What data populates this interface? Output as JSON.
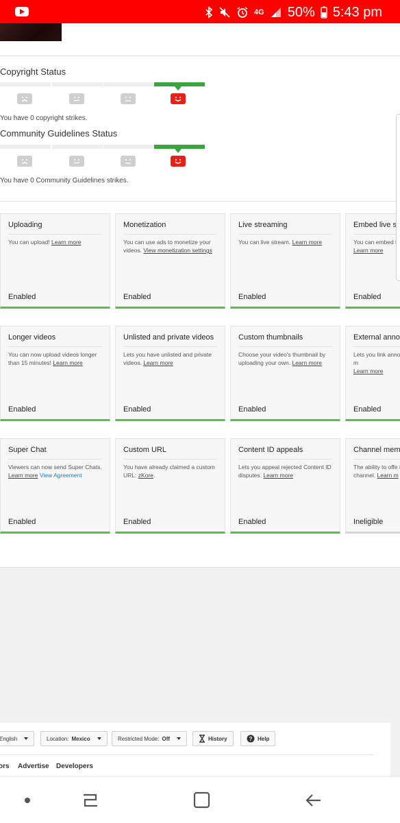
{
  "status_bar": {
    "network": "4G",
    "battery": "50%",
    "time": "5:43 pm"
  },
  "copyright": {
    "title": "Copyright Status",
    "note": "You have 0 copyright strikes."
  },
  "community": {
    "title": "Community Guidelines Status",
    "note": "You have 0 Community Guidelines strikes."
  },
  "cards": [
    {
      "title": "Uploading",
      "desc": "You can upload!",
      "link": "Learn more",
      "status": "Enabled"
    },
    {
      "title": "Monetization",
      "desc": "You can use ads to monetize your videos.",
      "link": "View monetization settings",
      "status": "Enabled"
    },
    {
      "title": "Live streaming",
      "desc": "You can live stream.",
      "link": "Learn more",
      "status": "Enabled"
    },
    {
      "title": "Embed live str",
      "desc": "You can embed li",
      "link": "Learn more",
      "status": "Enabled"
    },
    {
      "title": "Longer videos",
      "desc": "You can now upload videos longer than 15 minutes!",
      "link": "Learn more",
      "status": "Enabled"
    },
    {
      "title": "Unlisted and private videos",
      "desc": "Lets you have unlisted and private videos.",
      "link": "Learn more",
      "status": "Enabled"
    },
    {
      "title": "Custom thumbnails",
      "desc": "Choose your video's thumbnail by uploading your own.",
      "link": "Learn more",
      "status": "Enabled"
    },
    {
      "title": "External annot",
      "desc": "Lets you link anno external sites or m",
      "link": "Learn more",
      "status": "Enabled"
    },
    {
      "title": "Super Chat",
      "desc": "Viewers can now send Super Chats.",
      "link": "Learn more",
      "extra": "View Agreement",
      "status": "Enabled"
    },
    {
      "title": "Custom URL",
      "desc": "You have already claimed a custom URL:",
      "link": "zKore",
      "status": "Enabled"
    },
    {
      "title": "Content ID appeals",
      "desc": "Lets you appeal rejected Content ID disputes.",
      "link": "Learn more",
      "status": "Enabled"
    },
    {
      "title": "Channel memb",
      "desc": "The ability to offe isn't yet available channel.",
      "link": "Learn m",
      "status": "Ineligible"
    }
  ],
  "footer": {
    "language": "English",
    "location_label": "Location:",
    "location_value": "Mexico",
    "restricted_label": "Restricted Mode:",
    "restricted_value": "Off",
    "history": "History",
    "help": "Help",
    "links": [
      "ors",
      "Advertise",
      "Developers"
    ]
  },
  "colors": {
    "status_bar": "#ff0000",
    "enabled_bar": "#52c441",
    "meter_active": "#3aa43f",
    "face_active": "#e62117",
    "link_blue": "#167ac6"
  }
}
